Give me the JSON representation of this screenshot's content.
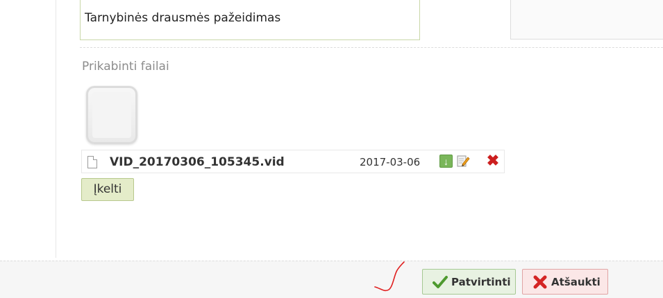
{
  "form": {
    "reason_value": "Tarnybinės drausmės pažeidimas"
  },
  "attachments": {
    "section_label": "Prikabinti failai",
    "files": [
      {
        "name": "VID_20170306_105345.vid",
        "date": "2017-03-06"
      }
    ],
    "upload_label": "Įkelti"
  },
  "footer": {
    "confirm_label": "Patvirtinti",
    "cancel_label": "Atšaukti"
  },
  "icons": {
    "file": "document-icon",
    "download": "download-icon",
    "edit": "edit-icon",
    "delete": "delete-icon",
    "confirm": "checkmark-icon",
    "cancel": "x-icon"
  },
  "colors": {
    "accent_green": "#7ab65a",
    "delete_red": "#cc1f1f",
    "annotation_red": "#e02020"
  }
}
